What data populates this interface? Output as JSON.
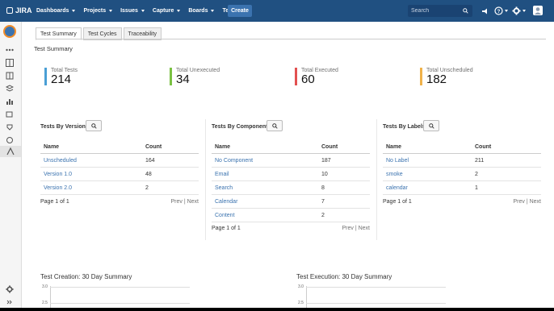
{
  "nav": {
    "logo": "JIRA",
    "menu": [
      "Dashboards",
      "Projects",
      "Issues",
      "Capture",
      "Boards",
      "Tests"
    ],
    "create": "Create",
    "search_placeholder": "Search"
  },
  "tabs": [
    "Test Summary",
    "Test Cycles",
    "Traceability"
  ],
  "section_title": "Test Summary",
  "metrics": [
    {
      "label": "Total Tests",
      "value": "214",
      "color": "#4a9fd5"
    },
    {
      "label": "Total Unexecuted",
      "value": "34",
      "color": "#7ac143"
    },
    {
      "label": "Total Executed",
      "value": "60",
      "color": "#e25050"
    },
    {
      "label": "Total Unscheduled",
      "value": "182",
      "color": "#f0b24a"
    }
  ],
  "panels": [
    {
      "title": "Tests By Versions",
      "columns": [
        "Name",
        "Count"
      ],
      "rows": [
        [
          "Unscheduled",
          "164"
        ],
        [
          "Version 1.0",
          "48"
        ],
        [
          "Version 2.0",
          "2"
        ]
      ],
      "page": "Page 1 of 1",
      "prev": "Prev",
      "sep": "|",
      "next": "Next"
    },
    {
      "title": "Tests By Components",
      "columns": [
        "Name",
        "Count"
      ],
      "rows": [
        [
          "No Component",
          "187"
        ],
        [
          "Email",
          "10"
        ],
        [
          "Search",
          "8"
        ],
        [
          "Calendar",
          "7"
        ],
        [
          "Content",
          "2"
        ]
      ],
      "page": "Page 1 of 1",
      "prev": "Prev",
      "sep": "|",
      "next": "Next"
    },
    {
      "title": "Tests By Labels",
      "columns": [
        "Name",
        "Count"
      ],
      "rows": [
        [
          "No Label",
          "211"
        ],
        [
          "smoke",
          "2"
        ],
        [
          "calendar",
          "1"
        ]
      ],
      "page": "Page 1 of 1",
      "prev": "Prev",
      "sep": "|",
      "next": "Next"
    }
  ],
  "charts": [
    {
      "title": "Test Creation: 30 Day Summary",
      "y_ticks": [
        "3.0",
        "2.5"
      ]
    },
    {
      "title": "Test Execution: 30 Day Summary",
      "y_ticks": [
        "3.0",
        "2.5"
      ]
    }
  ]
}
